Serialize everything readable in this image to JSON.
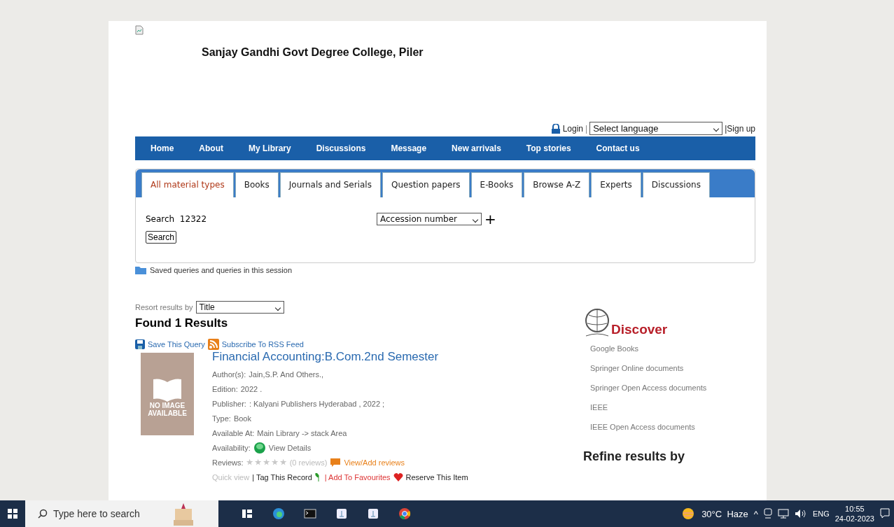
{
  "site_title": "Sanjay Gandhi Govt Degree College, Piler",
  "account": {
    "login": "Login",
    "separator": "|",
    "language": "Select language",
    "signup": "|Sign up"
  },
  "nav": [
    "Home",
    "About",
    "My Library",
    "Discussions",
    "Message",
    "New arrivals",
    "Top stories",
    "Contact us"
  ],
  "tabs": [
    {
      "label": "All material types",
      "selected": true
    },
    {
      "label": "Books",
      "selected": false
    },
    {
      "label": "Journals and Serials",
      "selected": false
    },
    {
      "label": "Question papers",
      "selected": false
    },
    {
      "label": "E-Books",
      "selected": false
    },
    {
      "label": "Browse A-Z",
      "selected": false
    },
    {
      "label": "Experts",
      "selected": false
    },
    {
      "label": "Discussions",
      "selected": false
    }
  ],
  "search": {
    "label": "Search",
    "value": "12322",
    "field": "Accession number",
    "add": "+",
    "button": "Search"
  },
  "saved_queries": "Saved queries and queries in this session",
  "resort": {
    "label": "Resort results by",
    "value": "Title"
  },
  "found": "Found 1 Results",
  "query_actions": [
    "Save This Query",
    "Subscribe To RSS Feed"
  ],
  "result": {
    "cover": [
      "NO IMAGE",
      "AVAILABLE"
    ],
    "title": "Financial Accounting:B.Com.2nd Semester",
    "fields": [
      {
        "label": "Author(s):",
        "value": "Jain,S.P. And Others.,"
      },
      {
        "label": "Edition:",
        "value": "2022 ."
      },
      {
        "label": "Publisher:",
        "value": ": Kalyani Publishers Hyderabad , 2022 ;"
      },
      {
        "label": "Type:",
        "value": "Book"
      },
      {
        "label": "Available At:",
        "value": "Main Library -> stack Area"
      }
    ],
    "availability": {
      "label": "Availability:",
      "link": "View Details"
    },
    "reviews": {
      "label": "Reviews:",
      "stars": 0,
      "count": "(0 reviews)",
      "link": "View/Add reviews"
    },
    "actions": [
      "Quick view",
      "| Tag This Record",
      "| Add To Favourites",
      "Reserve This Item"
    ]
  },
  "discover": {
    "title": "Discover",
    "links": [
      "Google Books",
      "Springer Online documents",
      "Springer Open Access documents",
      "IEEE",
      "IEEE Open Access documents"
    ]
  },
  "refine": "Refine results by",
  "taskbar": {
    "search": "Type here to search",
    "weather": "30°C  Haze",
    "tray_up": "^",
    "language": "ENG",
    "time": "10:55",
    "date": "24-02-2023"
  }
}
